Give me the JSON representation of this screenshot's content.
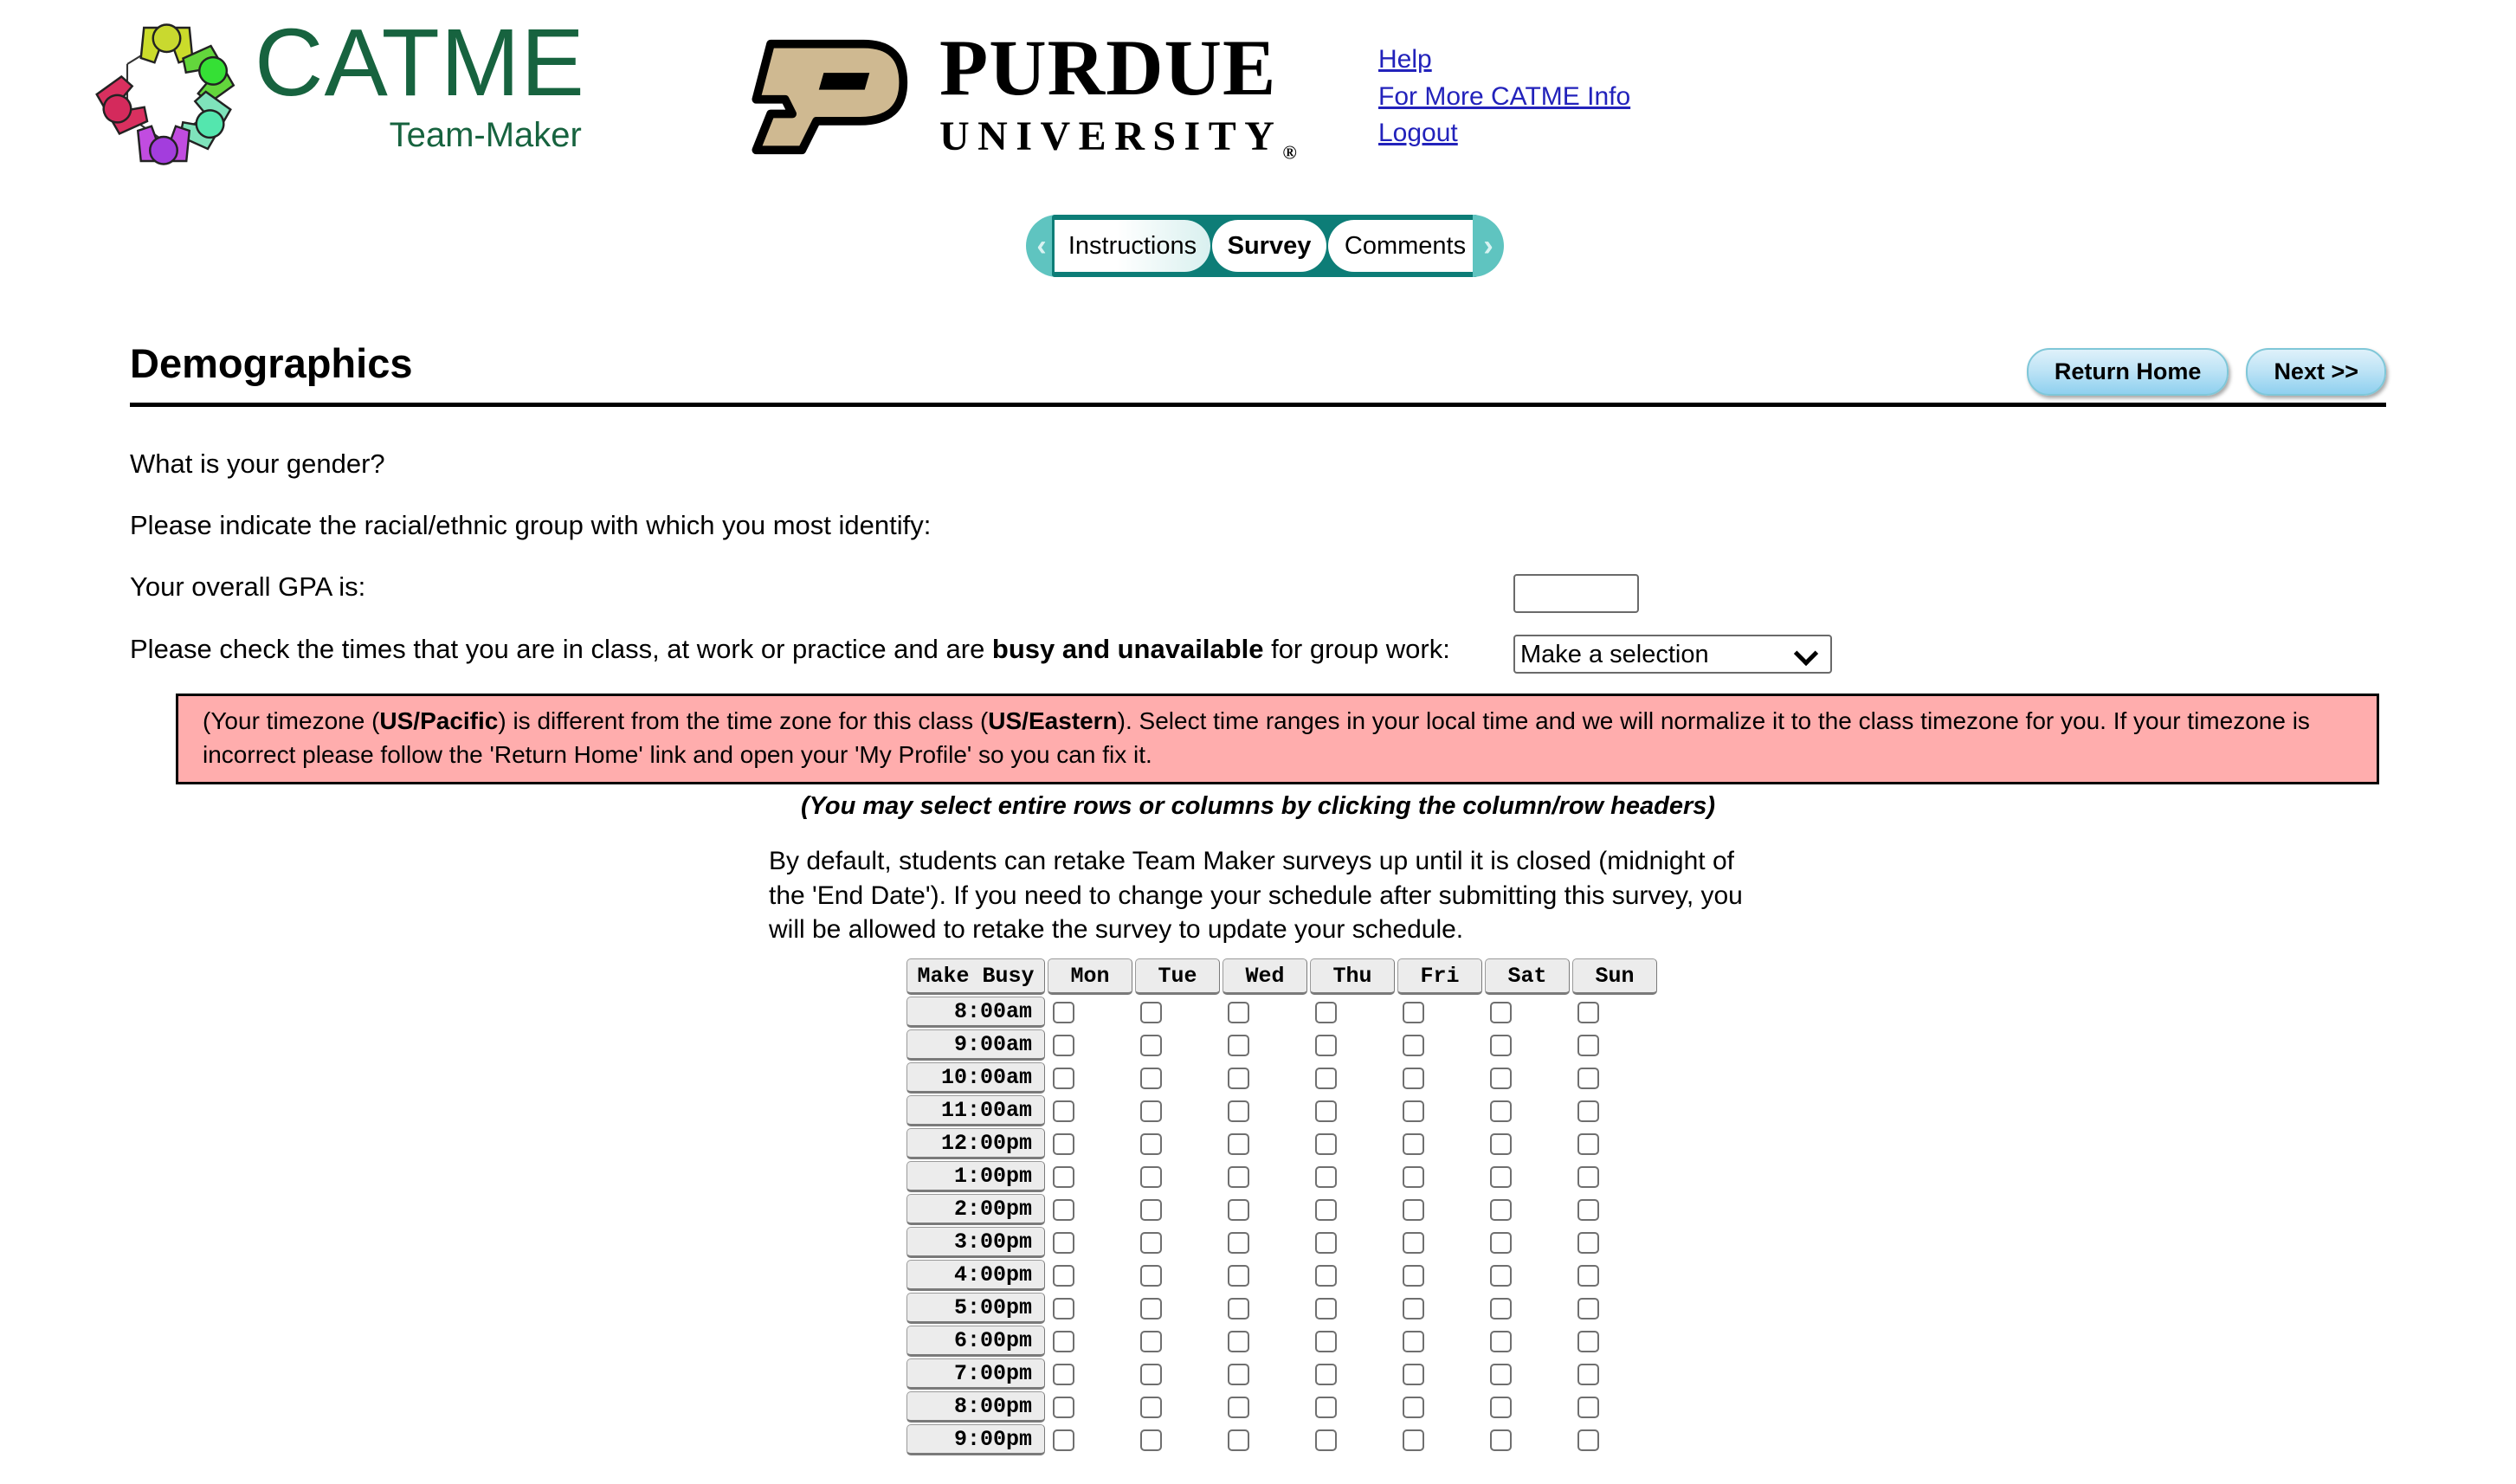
{
  "brand": {
    "catme_title": "CATME",
    "catme_subtitle": "Team-Maker",
    "purdue_line1": "PURDUE",
    "purdue_line2": "UNIVERSITY",
    "purdue_registered": "®",
    "accent_green": "#17633f",
    "purdue_gold": "#cfb991",
    "teal": "#0d7d77"
  },
  "header_links": [
    {
      "label": "Help"
    },
    {
      "label": "For More CATME Info"
    },
    {
      "label": "Logout"
    }
  ],
  "tabbar": {
    "prev_arrow": "‹",
    "next_arrow": "›",
    "tabs": [
      {
        "label": "Instructions",
        "active": false
      },
      {
        "label": "Survey",
        "active": true
      },
      {
        "label": "Comments",
        "active": false
      }
    ]
  },
  "page": {
    "title": "Demographics",
    "return_home_label": "Return Home",
    "next_label": "Next >>"
  },
  "questions": {
    "gender_label": "What is your gender?",
    "gender_value": "Make a selection",
    "ethnic_label": "Please indicate the racial/ethnic group with which you most identify:",
    "ethnic_value": "Make a selection",
    "gpa_label": "Your overall GPA is:",
    "gpa_value": "",
    "gpa_placeholder": "",
    "busy_prefix": "Please check the times that you are in class, at work or practice and are ",
    "busy_bold": "busy and unavailable",
    "busy_suffix": " for group work:"
  },
  "warning": {
    "part1": "(Your timezone (",
    "local_tz": "US/Pacific",
    "part2": ") is different from the time zone for this class (",
    "class_tz": "US/Eastern",
    "part3": "). Select time ranges in your local time and we will normalize it to the class timezone for you. If your timezone is incorrect please follow the 'Return Home' link and open your 'My Profile' so you can fix it.",
    "background": "#ffadad"
  },
  "notes": {
    "select_hint": "(You may select entire rows or columns by clicking the column/row headers)",
    "retake": "By default, students can retake Team Maker surveys up until it is closed (midnight of the 'End Date'). If you need to change your schedule after submitting this survey, you will be allowed to retake the survey to update your schedule."
  },
  "schedule": {
    "corner_label": "Make Busy",
    "days": [
      "Mon",
      "Tue",
      "Wed",
      "Thu",
      "Fri",
      "Sat",
      "Sun"
    ],
    "times": [
      "8:00am",
      "9:00am",
      "10:00am",
      "11:00am",
      "12:00pm",
      "1:00pm",
      "2:00pm",
      "3:00pm",
      "4:00pm",
      "5:00pm",
      "6:00pm",
      "7:00pm",
      "8:00pm",
      "9:00pm"
    ],
    "checked": []
  }
}
